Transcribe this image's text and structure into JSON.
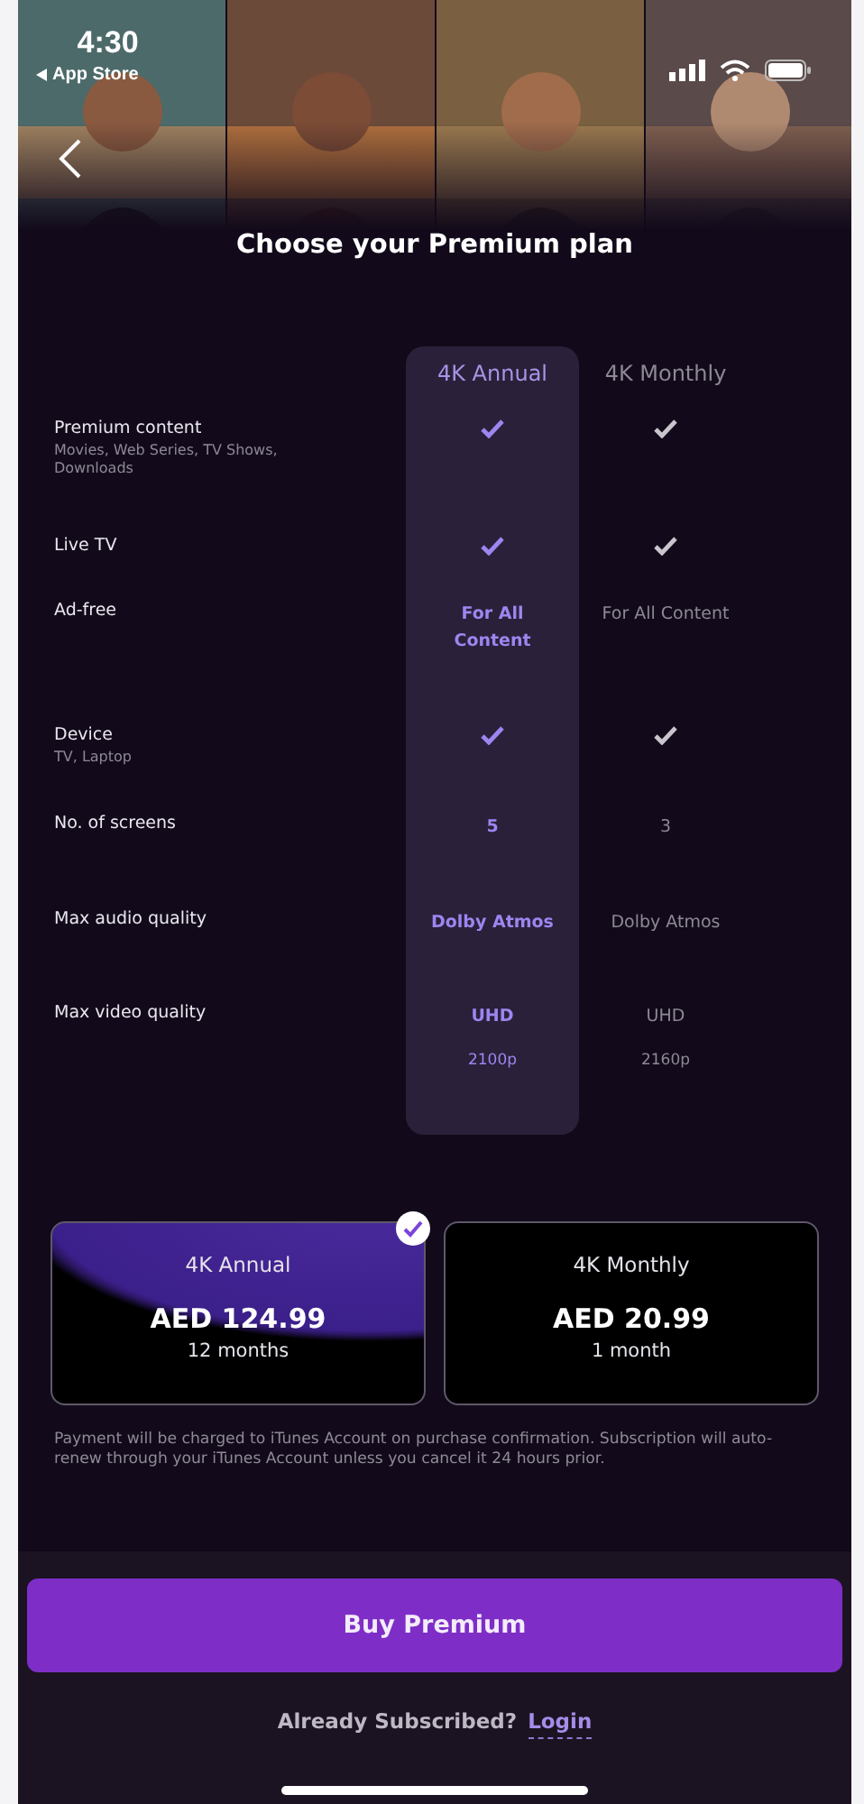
{
  "status_bar": {
    "time": "4:30",
    "back_app": "App Store"
  },
  "title": "Choose your Premium plan",
  "plans_header": [
    {
      "label": "4K Annual",
      "selected": true
    },
    {
      "label": "4K Monthly",
      "selected": false
    }
  ],
  "features": [
    {
      "label": "Premium content",
      "sublabel": "Movies, Web Series, TV Shows, Downloads",
      "values": [
        {
          "kind": "check"
        },
        {
          "kind": "check"
        }
      ]
    },
    {
      "label": "Live TV",
      "values": [
        {
          "kind": "check"
        },
        {
          "kind": "check"
        }
      ]
    },
    {
      "label": "Ad-free",
      "values": [
        {
          "kind": "text",
          "text": "For All Content"
        },
        {
          "kind": "text",
          "text": "For All Content"
        }
      ]
    },
    {
      "label": "Device",
      "sublabel": "TV, Laptop",
      "values": [
        {
          "kind": "check"
        },
        {
          "kind": "check"
        }
      ]
    },
    {
      "label": "No. of screens",
      "values": [
        {
          "kind": "text",
          "text": "5"
        },
        {
          "kind": "text",
          "text": "3"
        }
      ]
    },
    {
      "label": "Max audio quality",
      "values": [
        {
          "kind": "text",
          "text": "Dolby Atmos"
        },
        {
          "kind": "text",
          "text": "Dolby Atmos"
        }
      ]
    },
    {
      "label": "Max video quality",
      "values": [
        {
          "kind": "text",
          "text": "UHD",
          "subtext": "2100p"
        },
        {
          "kind": "text",
          "text": "UHD",
          "subtext": "2160p"
        }
      ]
    }
  ],
  "plan_cards": [
    {
      "name": "4K Annual",
      "price": "AED 124.99",
      "period": "12 months",
      "selected": true
    },
    {
      "name": "4K Monthly",
      "price": "AED 20.99",
      "period": "1 month",
      "selected": false
    }
  ],
  "disclaimer": "Payment will be charged to iTunes Account on purchase confirmation. Subscription will auto-renew through your iTunes Account unless you cancel it 24 hours prior.",
  "buy_button": "Buy Premium",
  "login_prompt": {
    "text": "Already Subscribed?",
    "link": "Login"
  }
}
